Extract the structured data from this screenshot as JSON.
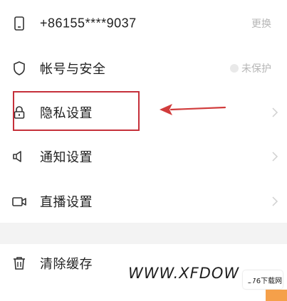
{
  "accent_color": "#c5303a",
  "settings": {
    "phone": {
      "label": "+86155****9037",
      "value": "更换",
      "icon": "phone-icon"
    },
    "account_security": {
      "label": "帐号与安全",
      "value": "未保护",
      "icon": "shield-icon"
    },
    "privacy": {
      "label": "隐私设置",
      "icon": "lock-icon"
    },
    "notifications": {
      "label": "通知设置",
      "icon": "speaker-icon"
    },
    "live": {
      "label": "直播设置",
      "icon": "camera-icon"
    },
    "cache": {
      "label": "清除缓存",
      "value": "",
      "icon": "trash-icon"
    }
  },
  "watermark": {
    "text": "WWW.XFDOW",
    "logo_text": "176下载网"
  }
}
